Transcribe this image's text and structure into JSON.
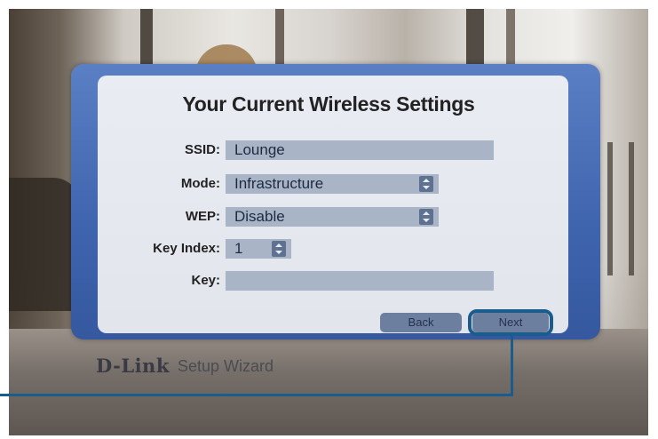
{
  "dialog": {
    "title": "Your Current Wireless Settings",
    "ssid": {
      "label": "SSID:",
      "value": "Lounge"
    },
    "mode": {
      "label": "Mode:",
      "value": "Infrastructure"
    },
    "wep": {
      "label": "WEP:",
      "value": "Disable"
    },
    "key_index": {
      "label": "Key Index:",
      "value": "1"
    },
    "key": {
      "label": "Key:",
      "value": ""
    },
    "back_label": "Back",
    "next_label": "Next"
  },
  "branding": {
    "logo": "D-Link",
    "subtitle": "Setup Wizard"
  },
  "colors": {
    "frame": "#3f64ae",
    "panel": "#e5e8ee",
    "field": "#a9b5c7",
    "highlight": "#1a5c8b"
  }
}
